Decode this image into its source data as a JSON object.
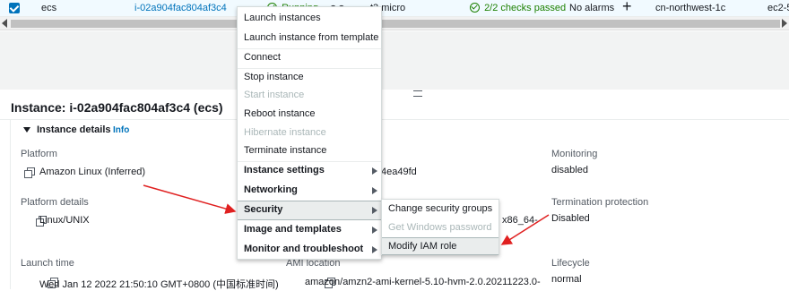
{
  "row": {
    "name": "ecs",
    "instance_id": "i-02a904fac804af3c4",
    "state": "Running",
    "zoom_icons": "⊕⊖",
    "type": "t3.micro",
    "status_check": "2/2 checks passed",
    "alarm": "No alarms",
    "add": "+",
    "az": "cn-northwest-1c",
    "dns": "ec2-5"
  },
  "details": {
    "title": "Instance: i-02a904fac804af3c4 (ecs)",
    "section": "Instance details",
    "info": "Info",
    "platform_label": "Platform",
    "platform_value": "Amazon Linux (Inferred)",
    "platform_details_label": "Platform details",
    "platform_details_value": "Linux/UNIX",
    "launch_time_label": "Launch time",
    "launch_time_value": "Wed Jan 12 2022 21:50:10 GMT+0800 (中国标准时间)",
    "ami_id_partial": "4ea49fd",
    "ami_name_partial": "x86_64-",
    "ami_location_label": "AMI location",
    "ami_location_value": "amazon/amzn2-ami-kernel-5.10-hvm-2.0.20211223.0-",
    "monitoring_label": "Monitoring",
    "monitoring_value": "disabled",
    "termination_label": "Termination protection",
    "termination_value": "Disabled",
    "lifecycle_label": "Lifecycle",
    "lifecycle_value": "normal"
  },
  "menu": {
    "launch": "Launch instances",
    "launch_template": "Launch instance from template",
    "connect": "Connect",
    "stop": "Stop instance",
    "start": "Start instance",
    "reboot": "Reboot instance",
    "hibernate": "Hibernate instance",
    "terminate": "Terminate instance",
    "instance_settings": "Instance settings",
    "networking": "Networking",
    "security": "Security",
    "image_templates": "Image and templates",
    "monitor": "Monitor and troubleshoot"
  },
  "submenu": {
    "change_sg": "Change security groups",
    "get_password": "Get Windows password",
    "modify_iam": "Modify IAM role"
  },
  "colors": {
    "accent": "#0073bb",
    "success": "#1d8102",
    "annotation_arrow": "#e02020"
  }
}
